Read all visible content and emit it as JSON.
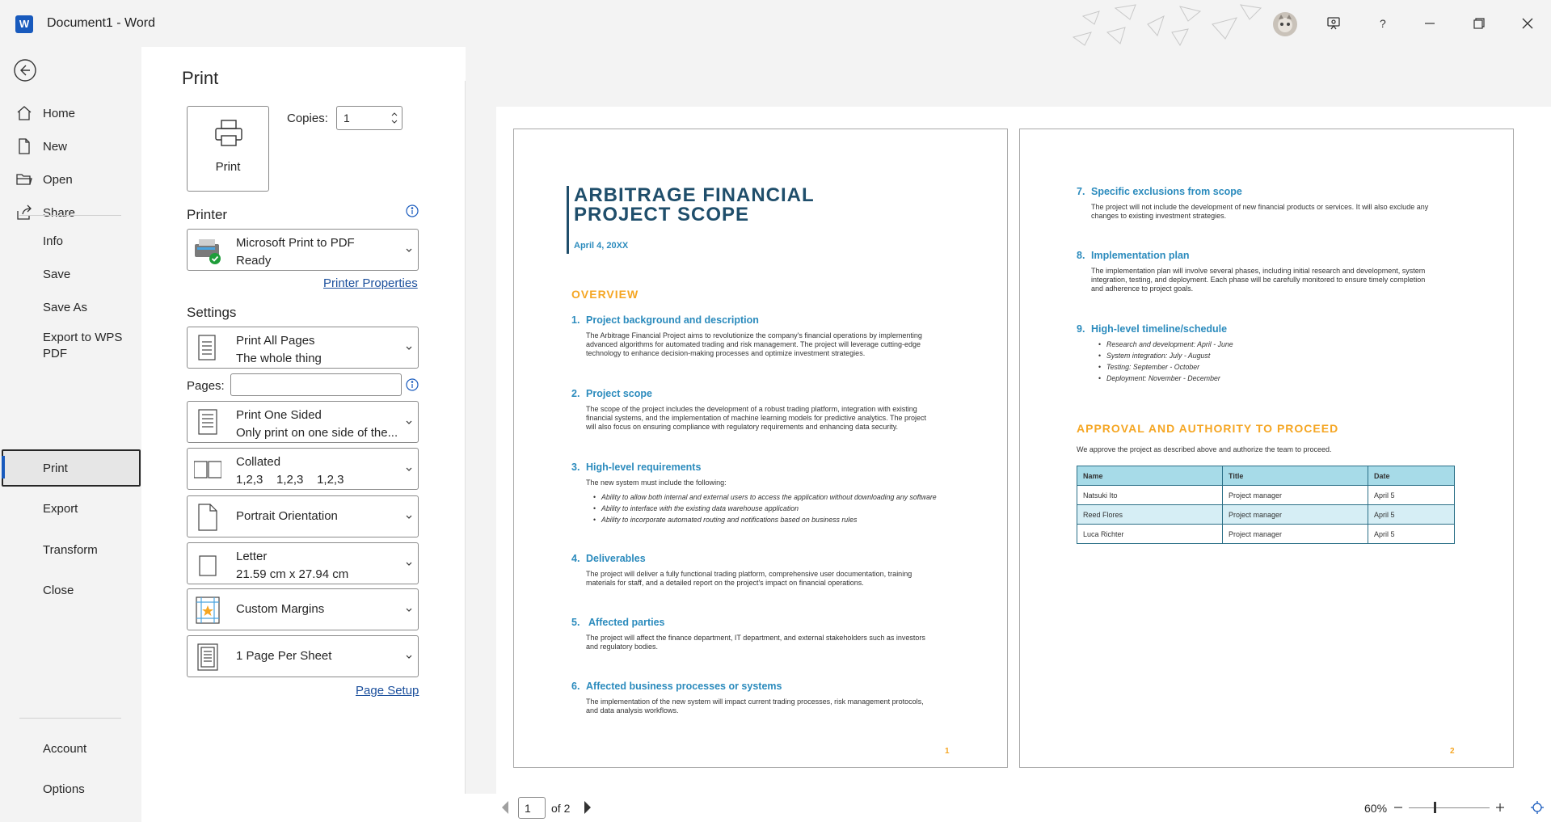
{
  "window": {
    "app_icon": "W",
    "title": "Document1  -  Word"
  },
  "nav": {
    "items": [
      "Home",
      "New",
      "Open",
      "Share",
      "Info",
      "Save",
      "Save As",
      "Export to WPS PDF",
      "Print",
      "Export",
      "Transform",
      "Close"
    ],
    "bottom_items": [
      "Account",
      "Options"
    ],
    "selected": "Print"
  },
  "print": {
    "heading": "Print",
    "print_button_label": "Print",
    "copies_label": "Copies:",
    "copies_value": "1",
    "printer_heading": "Printer",
    "printer_name": "Microsoft Print to PDF",
    "printer_status": "Ready",
    "printer_properties": "Printer Properties",
    "settings_heading": "Settings",
    "pages_label": "Pages:",
    "pages_value": "",
    "range": {
      "title": "Print All Pages",
      "sub": "The whole thing"
    },
    "sides": {
      "title": "Print One Sided",
      "sub": "Only print on one side of the..."
    },
    "collate": {
      "title": "Collated",
      "sub": "1,2,3    1,2,3    1,2,3"
    },
    "orientation": "Portrait Orientation",
    "paper": {
      "title": "Letter",
      "sub": "21.59 cm x 27.94 cm"
    },
    "margins": "Custom Margins",
    "pages_per_sheet": "1 Page Per Sheet",
    "page_setup": "Page Setup"
  },
  "preview": {
    "current_page": "1",
    "of_pages": "of 2",
    "zoom": "60%",
    "page1": {
      "title_line1": "ARBITRAGE FINANCIAL",
      "title_line2": "PROJECT SCOPE",
      "date": "April 4, 20XX",
      "overview": "OVERVIEW",
      "sections": [
        {
          "num": "1.",
          "head": "Project background and description",
          "lines": [
            "The Arbitrage Financial Project aims to revolutionize the company's financial operations by implementing",
            "advanced algorithms for automated trading and risk management. The project will leverage cutting-edge",
            "technology to enhance decision-making processes and optimize investment strategies."
          ]
        },
        {
          "num": "2.",
          "head": "Project scope",
          "lines": [
            "The scope of the project includes the development of a robust trading platform, integration with existing",
            "financial systems, and the implementation of machine learning models for predictive analytics. The project",
            "will also focus on ensuring compliance with regulatory requirements and enhancing data security."
          ]
        },
        {
          "num": "3.",
          "head": "High-level requirements",
          "lines": [
            "The new system must include the following:"
          ]
        },
        {
          "num": "4.",
          "head": "Deliverables",
          "lines": [
            "The project will deliver a fully functional trading platform, comprehensive user documentation, training",
            "materials for staff, and a detailed report on the project's impact on financial operations."
          ]
        },
        {
          "num": "5.",
          "head": " Affected parties",
          "lines": [
            "The project will affect the finance department, IT department, and external stakeholders such as investors",
            "and regulatory bodies."
          ]
        },
        {
          "num": "6.",
          "head": "Affected business processes or systems",
          "lines": [
            "The implementation of the new system will impact current trading processes, risk management protocols,",
            "and data analysis workflows."
          ]
        }
      ],
      "requirements": [
        "Ability to allow both internal and external users to access the application without downloading any software",
        "Ability to interface with the existing data warehouse application",
        "Ability to incorporate automated routing and notifications based on business rules"
      ],
      "page_number": "1"
    },
    "page2": {
      "sections": [
        {
          "num": "7.",
          "head": "Specific exclusions from scope",
          "lines": [
            "The project will not include the development of new financial products or services. It will also exclude any",
            "changes to existing investment strategies."
          ]
        },
        {
          "num": "8.",
          "head": "Implementation plan",
          "lines": [
            "The implementation plan will involve several phases, including initial research and development, system",
            "integration, testing, and deployment. Each phase will be carefully monitored to ensure timely completion",
            "and adherence to project goals."
          ]
        },
        {
          "num": "9.",
          "head": "High-level timeline/schedule",
          "lines": []
        }
      ],
      "timeline": [
        "Research and development: April - June",
        "System integration: July - August",
        "Testing: September - October",
        "Deployment: November - December"
      ],
      "approval_heading": "APPROVAL AND AUTHORITY TO PROCEED",
      "approval_text": "We approve the project as described above and authorize the team to proceed.",
      "table": {
        "headers": [
          "Name",
          "Title",
          "Date"
        ],
        "rows": [
          [
            "Natsuki Ito",
            "Project manager",
            "April 5"
          ],
          [
            "Reed Flores",
            "Project manager",
            "April 5"
          ],
          [
            "Luca Richter",
            "Project manager",
            "April 5"
          ]
        ]
      },
      "page_number": "2"
    }
  },
  "colors": {
    "accent": "#185abd",
    "doc_blue": "#2b8bbd",
    "doc_title": "#1f4e6b",
    "doc_orange": "#f5a623",
    "table_head": "#a7dbe8"
  }
}
